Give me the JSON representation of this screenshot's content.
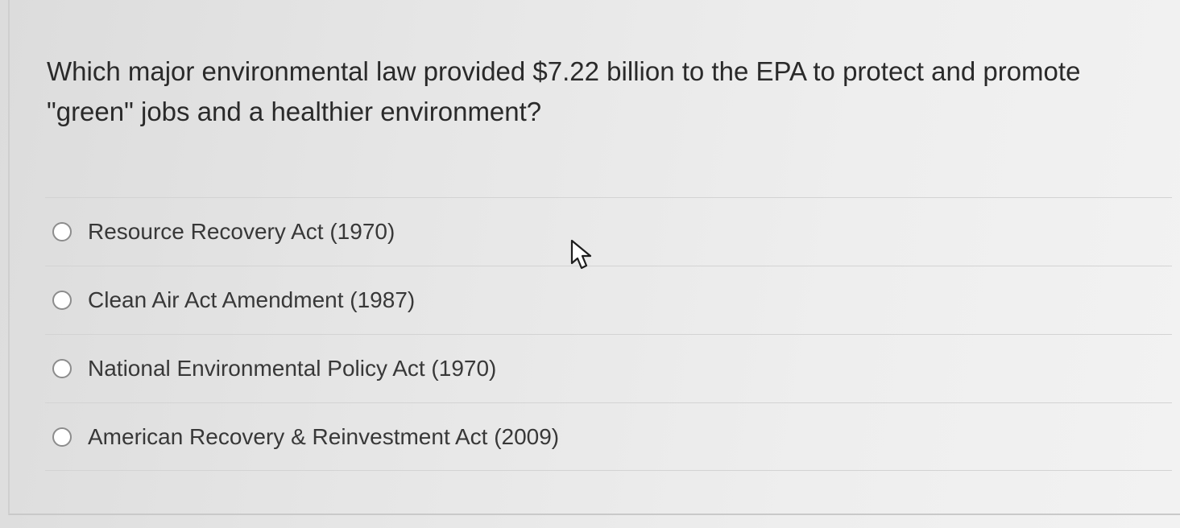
{
  "question": {
    "text": "Which major environmental law provided $7.22 billion to the EPA to protect and promote \"green\" jobs and a healthier environment?"
  },
  "answers": [
    {
      "label": "Resource Recovery Act (1970)",
      "selected": false
    },
    {
      "label": "Clean Air Act Amendment (1987)",
      "selected": false
    },
    {
      "label": "National Environmental Policy Act (1970)",
      "selected": false
    },
    {
      "label": "American Recovery & Reinvestment Act (2009)",
      "selected": false
    }
  ],
  "colors": {
    "radio_border": "#8c8c8c",
    "text": "#2f2f2f",
    "divider": "#d3d3d3"
  },
  "icons": {
    "pointer": "mouse-pointer-icon"
  }
}
